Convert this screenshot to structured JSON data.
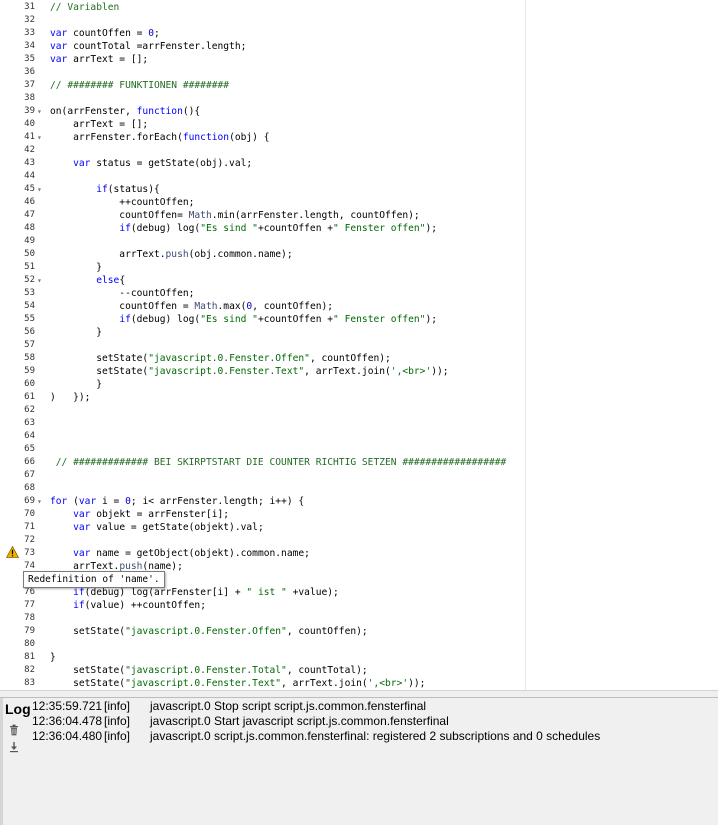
{
  "editor": {
    "lines": [
      {
        "n": "31",
        "fold": "",
        "tokens": [
          {
            "t": "// Variablen",
            "c": "cm"
          }
        ]
      },
      {
        "n": "32",
        "fold": "",
        "tokens": []
      },
      {
        "n": "33",
        "fold": "",
        "tokens": [
          {
            "t": "var",
            "c": "kw"
          },
          {
            "t": " countOffen = ",
            "c": "plain"
          },
          {
            "t": "0",
            "c": "num"
          },
          {
            "t": ";",
            "c": "plain"
          }
        ]
      },
      {
        "n": "34",
        "fold": "",
        "tokens": [
          {
            "t": "var",
            "c": "kw"
          },
          {
            "t": " countTotal =arrFenster.length;",
            "c": "plain"
          }
        ]
      },
      {
        "n": "35",
        "fold": "",
        "tokens": [
          {
            "t": "var",
            "c": "kw"
          },
          {
            "t": " arrText = [];",
            "c": "plain"
          }
        ]
      },
      {
        "n": "36",
        "fold": "",
        "tokens": []
      },
      {
        "n": "37",
        "fold": "",
        "tokens": [
          {
            "t": "// ######## FUNKTIONEN ########",
            "c": "cm"
          }
        ]
      },
      {
        "n": "38",
        "fold": "",
        "tokens": []
      },
      {
        "n": "39",
        "fold": "▾",
        "tokens": [
          {
            "t": "on(arrFenster, ",
            "c": "plain"
          },
          {
            "t": "function",
            "c": "kw"
          },
          {
            "t": "(){",
            "c": "plain"
          }
        ]
      },
      {
        "n": "40",
        "fold": "",
        "tokens": [
          {
            "t": "    arrText = [];",
            "c": "plain"
          }
        ]
      },
      {
        "n": "41",
        "fold": "▾",
        "tokens": [
          {
            "t": "    arrFenster.forEach(",
            "c": "plain"
          },
          {
            "t": "function",
            "c": "kw"
          },
          {
            "t": "(obj) {",
            "c": "plain"
          }
        ]
      },
      {
        "n": "42",
        "fold": "",
        "tokens": []
      },
      {
        "n": "43",
        "fold": "",
        "tokens": [
          {
            "t": "    ",
            "c": "plain"
          },
          {
            "t": "var",
            "c": "kw"
          },
          {
            "t": " status = getState(obj).val;",
            "c": "plain"
          }
        ]
      },
      {
        "n": "44",
        "fold": "",
        "tokens": []
      },
      {
        "n": "45",
        "fold": "▾",
        "tokens": [
          {
            "t": "        ",
            "c": "plain"
          },
          {
            "t": "if",
            "c": "kw"
          },
          {
            "t": "(status){",
            "c": "plain"
          }
        ]
      },
      {
        "n": "46",
        "fold": "",
        "tokens": [
          {
            "t": "            ++countOffen;",
            "c": "plain"
          }
        ]
      },
      {
        "n": "47",
        "fold": "",
        "tokens": [
          {
            "t": "            countOffen= ",
            "c": "plain"
          },
          {
            "t": "Math",
            "c": "fn"
          },
          {
            "t": ".min(arrFenster.length, countOffen);",
            "c": "plain"
          }
        ]
      },
      {
        "n": "48",
        "fold": "",
        "tokens": [
          {
            "t": "            ",
            "c": "plain"
          },
          {
            "t": "if",
            "c": "kw"
          },
          {
            "t": "(debug) log(",
            "c": "plain"
          },
          {
            "t": "\"Es sind \"",
            "c": "str"
          },
          {
            "t": "+countOffen +",
            "c": "plain"
          },
          {
            "t": "\" Fenster offen\"",
            "c": "str"
          },
          {
            "t": ");",
            "c": "plain"
          }
        ]
      },
      {
        "n": "49",
        "fold": "",
        "tokens": []
      },
      {
        "n": "50",
        "fold": "",
        "tokens": [
          {
            "t": "            arrText.",
            "c": "plain"
          },
          {
            "t": "push",
            "c": "fn"
          },
          {
            "t": "(obj.common.name);",
            "c": "plain"
          }
        ]
      },
      {
        "n": "51",
        "fold": "",
        "tokens": [
          {
            "t": "        }",
            "c": "plain"
          }
        ]
      },
      {
        "n": "52",
        "fold": "▾",
        "tokens": [
          {
            "t": "        ",
            "c": "plain"
          },
          {
            "t": "else",
            "c": "kw"
          },
          {
            "t": "{",
            "c": "plain"
          }
        ]
      },
      {
        "n": "53",
        "fold": "",
        "tokens": [
          {
            "t": "            --countOffen;",
            "c": "plain"
          }
        ]
      },
      {
        "n": "54",
        "fold": "",
        "tokens": [
          {
            "t": "            countOffen = ",
            "c": "plain"
          },
          {
            "t": "Math",
            "c": "fn"
          },
          {
            "t": ".max(",
            "c": "plain"
          },
          {
            "t": "0",
            "c": "num"
          },
          {
            "t": ", countOffen);",
            "c": "plain"
          }
        ]
      },
      {
        "n": "55",
        "fold": "",
        "tokens": [
          {
            "t": "            ",
            "c": "plain"
          },
          {
            "t": "if",
            "c": "kw"
          },
          {
            "t": "(debug) log(",
            "c": "plain"
          },
          {
            "t": "\"Es sind \"",
            "c": "str"
          },
          {
            "t": "+countOffen +",
            "c": "plain"
          },
          {
            "t": "\" Fenster offen\"",
            "c": "str"
          },
          {
            "t": ");",
            "c": "plain"
          }
        ]
      },
      {
        "n": "56",
        "fold": "",
        "tokens": [
          {
            "t": "        }",
            "c": "plain"
          }
        ]
      },
      {
        "n": "57",
        "fold": "",
        "tokens": []
      },
      {
        "n": "58",
        "fold": "",
        "tokens": [
          {
            "t": "        setState(",
            "c": "plain"
          },
          {
            "t": "\"javascript.0.Fenster.Offen\"",
            "c": "str"
          },
          {
            "t": ", countOffen);",
            "c": "plain"
          }
        ]
      },
      {
        "n": "59",
        "fold": "",
        "tokens": [
          {
            "t": "        setState(",
            "c": "plain"
          },
          {
            "t": "\"javascript.0.Fenster.Text\"",
            "c": "str"
          },
          {
            "t": ", arrText.join(",
            "c": "plain"
          },
          {
            "t": "',<br>'",
            "c": "str"
          },
          {
            "t": "));",
            "c": "plain"
          }
        ]
      },
      {
        "n": "60",
        "fold": "",
        "tokens": [
          {
            "t": "        }",
            "c": "plain"
          }
        ]
      },
      {
        "n": "61",
        "fold": "",
        "tokens": [
          {
            "t": ")   });",
            "c": "plain"
          }
        ]
      },
      {
        "n": "62",
        "fold": "",
        "tokens": []
      },
      {
        "n": "63",
        "fold": "",
        "tokens": []
      },
      {
        "n": "64",
        "fold": "",
        "tokens": []
      },
      {
        "n": "65",
        "fold": "",
        "tokens": []
      },
      {
        "n": "66",
        "fold": "",
        "tokens": [
          {
            "t": " // ############# BEI SKIRPTSTART DIE COUNTER RICHTIG SETZEN ##################",
            "c": "cm"
          }
        ]
      },
      {
        "n": "67",
        "fold": "",
        "tokens": []
      },
      {
        "n": "68",
        "fold": "",
        "tokens": []
      },
      {
        "n": "69",
        "fold": "▾",
        "tokens": [
          {
            "t": "for",
            "c": "kw"
          },
          {
            "t": " (",
            "c": "plain"
          },
          {
            "t": "var",
            "c": "kw"
          },
          {
            "t": " i = ",
            "c": "plain"
          },
          {
            "t": "0",
            "c": "num"
          },
          {
            "t": "; i< arrFenster.length; i++) {",
            "c": "plain"
          }
        ]
      },
      {
        "n": "70",
        "fold": "",
        "tokens": [
          {
            "t": "    ",
            "c": "plain"
          },
          {
            "t": "var",
            "c": "kw"
          },
          {
            "t": " objekt = arrFenster[i];",
            "c": "plain"
          }
        ]
      },
      {
        "n": "71",
        "fold": "",
        "tokens": [
          {
            "t": "    ",
            "c": "plain"
          },
          {
            "t": "var",
            "c": "kw"
          },
          {
            "t": " value = getState(objekt).val;",
            "c": "plain"
          }
        ]
      },
      {
        "n": "72",
        "fold": "",
        "tokens": []
      },
      {
        "n": "73",
        "fold": "",
        "tokens": [
          {
            "t": "    ",
            "c": "plain"
          },
          {
            "t": "var",
            "c": "kw"
          },
          {
            "t": " name = getObject(objekt).common.name;",
            "c": "plain"
          }
        ]
      },
      {
        "n": "74",
        "fold": "",
        "tokens": [
          {
            "t": "    arrText.",
            "c": "plain"
          },
          {
            "t": "push",
            "c": "fn"
          },
          {
            "t": "(name);",
            "c": "plain"
          }
        ]
      },
      {
        "n": "75",
        "fold": "",
        "tokens": []
      },
      {
        "n": "76",
        "fold": "",
        "tokens": [
          {
            "t": "    ",
            "c": "plain"
          },
          {
            "t": "if",
            "c": "kw"
          },
          {
            "t": "(debug) log(arrFenster[i] + ",
            "c": "plain"
          },
          {
            "t": "\" ist \"",
            "c": "str"
          },
          {
            "t": " +value);",
            "c": "plain"
          }
        ]
      },
      {
        "n": "77",
        "fold": "",
        "tokens": [
          {
            "t": "    ",
            "c": "plain"
          },
          {
            "t": "if",
            "c": "kw"
          },
          {
            "t": "(value) ++countOffen;",
            "c": "plain"
          }
        ]
      },
      {
        "n": "78",
        "fold": "",
        "tokens": []
      },
      {
        "n": "79",
        "fold": "",
        "tokens": [
          {
            "t": "    setState(",
            "c": "plain"
          },
          {
            "t": "\"javascript.0.Fenster.Offen\"",
            "c": "str"
          },
          {
            "t": ", countOffen);",
            "c": "plain"
          }
        ]
      },
      {
        "n": "80",
        "fold": "",
        "tokens": []
      },
      {
        "n": "81",
        "fold": "",
        "tokens": [
          {
            "t": "}",
            "c": "plain"
          }
        ]
      },
      {
        "n": "82",
        "fold": "",
        "tokens": [
          {
            "t": "    setState(",
            "c": "plain"
          },
          {
            "t": "\"javascript.0.Fenster.Total\"",
            "c": "str"
          },
          {
            "t": ", countTotal);",
            "c": "plain"
          }
        ]
      },
      {
        "n": "83",
        "fold": "",
        "tokens": [
          {
            "t": "    setState(",
            "c": "plain"
          },
          {
            "t": "\"javascript.0.Fenster.Text\"",
            "c": "str"
          },
          {
            "t": ", arrText.join(",
            "c": "plain"
          },
          {
            "t": "',<br>'",
            "c": "str"
          },
          {
            "t": "));",
            "c": "plain"
          }
        ]
      }
    ],
    "warning": {
      "line": "73",
      "icon": "warning-triangle-icon",
      "tooltip": "Redefinition of 'name'."
    },
    "colors": {
      "keyword": "#0000ff",
      "string": "#036a07",
      "number": "#0000cd",
      "comment": "#236e24",
      "builtin": "#3c4c72",
      "warning": "#f0b000"
    }
  },
  "log": {
    "title": "Log",
    "icons": [
      "trash-icon",
      "download-icon"
    ],
    "entries": [
      {
        "time": "12:35:59.721",
        "level": "[info]",
        "message": "javascript.0 Stop script script.js.common.fensterfinal"
      },
      {
        "time": "12:36:04.478",
        "level": "[info]",
        "message": "javascript.0 Start javascript script.js.common.fensterfinal"
      },
      {
        "time": "12:36:04.480",
        "level": "[info]",
        "message": "javascript.0 script.js.common.fensterfinal: registered 2 subscriptions and 0 schedules"
      }
    ]
  }
}
